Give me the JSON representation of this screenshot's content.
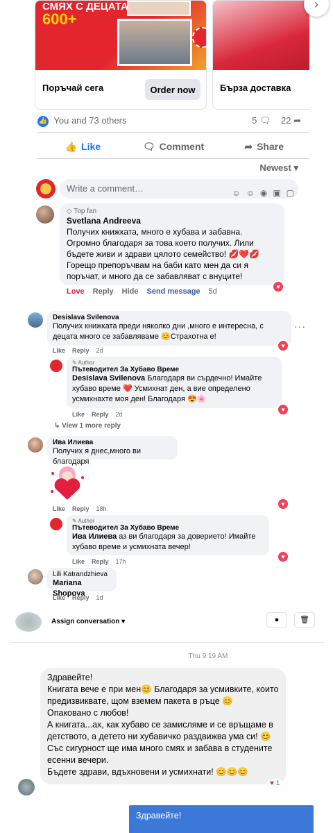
{
  "ads": {
    "card1": {
      "cover_title": "СМЯХ С ДЕЦАТА",
      "cover_number": "600+",
      "label": "Поръчай сега",
      "button": "Order now"
    },
    "card2": {
      "label": "Бърза доставка"
    },
    "next_arrow": "›"
  },
  "post": {
    "reactions_text": "You and 73 others",
    "comments_count": "5",
    "shares_count": "22",
    "actions": {
      "like": "Like",
      "comment": "Comment",
      "share": "Share"
    },
    "sort_label": "Newest",
    "composer_placeholder": "Write a comment…"
  },
  "top_comment": {
    "badge": "Top fan",
    "author": "Svetlana Andreeva",
    "text": "Получих книжката, много е хубава и забавна. Огромно благодаря за това което получих. Лили бъдете живи и здрави цялото семейство! 💋❤️💋 Горещо препоръчвам на баби като мен да си я поръчат, и много да се забавляват с внуците!",
    "meta": {
      "love": "Love",
      "reply": "Reply",
      "hide": "Hide",
      "send": "Send message",
      "time": "5d"
    }
  },
  "thread": {
    "c1": {
      "author": "Desislava Svilenova",
      "text": "Получих книжката преди няколко дни ,много е интересна, с децата много се забавляваме 😊Страхотна е!",
      "like": "Like",
      "reply": "Reply",
      "time": "2d"
    },
    "r1": {
      "tag": "Author",
      "author": "Пътеводител За Хубаво Време",
      "mention": "Desislava Svilenova",
      "text": " Благодаря ви сърдечно! Имайте хубаво време ❤️ Усмихнат ден, а вие определено усмихнахте моя ден! Благодаря 😍🌸",
      "like": "Like",
      "reply": "Reply",
      "time": "2d"
    },
    "view_more": "View 1 more reply",
    "c2": {
      "author": "Ива Илиева",
      "text": "Получих я днес,много ви благодаря",
      "like": "Like",
      "reply": "Reply",
      "time": "18h"
    },
    "r2": {
      "tag": "Author",
      "author": "Пътеводител За Хубаво Време",
      "mention": "Ива Илиева",
      "text": " аз ви благодаря за доверието! Имайте хубаво време и усмихната вечер!",
      "like": "Like",
      "reply": "Reply",
      "time": "17h"
    },
    "c3": {
      "author": "Lili Katrandzhieva",
      "mention": "Mariana Shopova",
      "like": "Like",
      "reply": "Reply",
      "time": "1d"
    }
  },
  "inbox": {
    "assign_label": "Assign conversation",
    "timestamp": "Thu 9:19 AM",
    "message_lines": [
      "Здравейте!",
      "Книгата вече е при мен😊 Благодаря за усмивките, които предизвиквате, щом вземем пакета в ръце 😊",
      "Опаковано с любов!",
      "А книгата...ах, как хубаво се замисляме и се връщаме в детството, а детето ни хубавичко раздвижва ума си! 😊",
      "Със сигурност ще има много смях и забава в студените есенни вечери.",
      "Бъдете здрави, вдъхновени и усмихнати! 😊😊😊"
    ],
    "message_reaction": "1",
    "outgoing": "Здравейте!"
  },
  "colors": {
    "accent": "#1877f2",
    "love": "#e41e3f",
    "outgoing": "#3b78d8"
  }
}
